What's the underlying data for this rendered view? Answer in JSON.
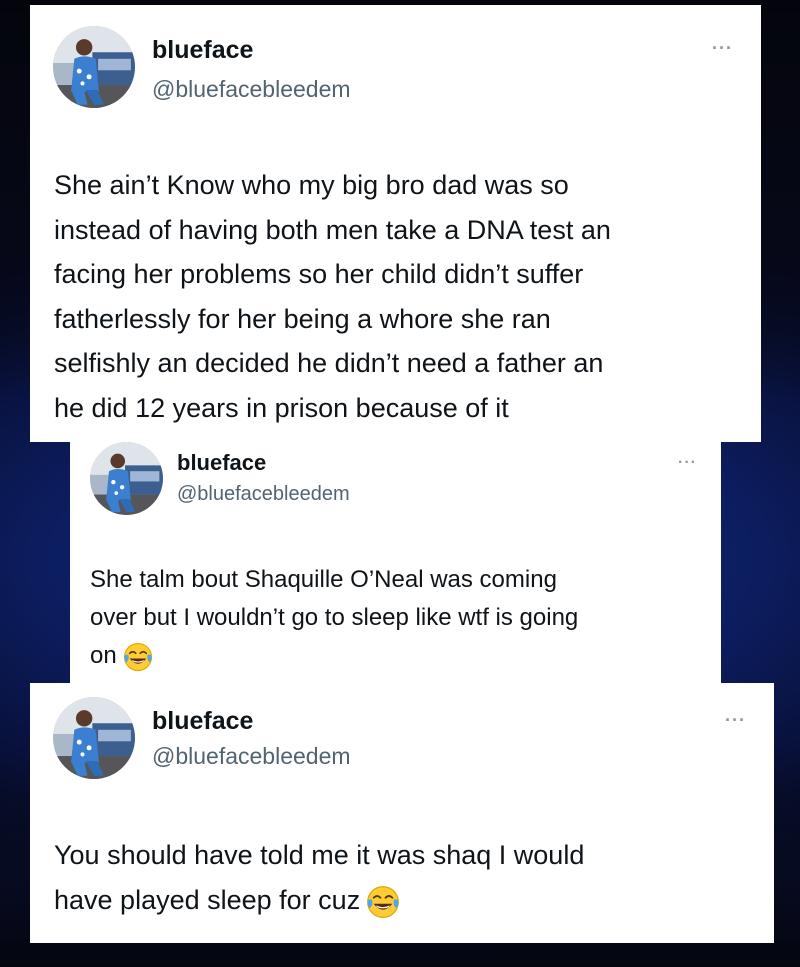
{
  "tweets": [
    {
      "display_name": "blueface",
      "handle": "@bluefacebleedem",
      "more_glyph": "···",
      "avatar_icon": "profile-photo-avatar",
      "text_lines": [
        "She ain’t Know who my big bro dad was so",
        "instead of having both men take a DNA test an",
        "facing her problems so her child didn’t suffer",
        "fatherlessly for her being a whore she ran",
        "selfishly an decided he didn’t need a father an",
        "he did 12 years in prison because of it"
      ]
    },
    {
      "display_name": "blueface",
      "handle": "@bluefacebleedem",
      "more_glyph": "···",
      "avatar_icon": "profile-photo-avatar",
      "text_lines": [
        "She talm bout Shaquille O’Neal was coming",
        "over but I wouldn’t go to sleep like wtf is going",
        "on"
      ],
      "trailing_emoji": "tears-of-joy-emoji"
    },
    {
      "display_name": "blueface",
      "handle": "@bluefacebleedem",
      "more_glyph": "···",
      "avatar_icon": "profile-photo-avatar",
      "text_lines": [
        "You should have told me it was shaq I would",
        "have played sleep for cuz"
      ],
      "trailing_emoji": "tears-of-joy-emoji"
    }
  ],
  "colors": {
    "name": "#0f1419",
    "handle": "#536471",
    "more": "#8b98a5",
    "card_background": "#ffffff",
    "page_background_glow": "#16349a",
    "page_background_dark": "#03050f"
  }
}
